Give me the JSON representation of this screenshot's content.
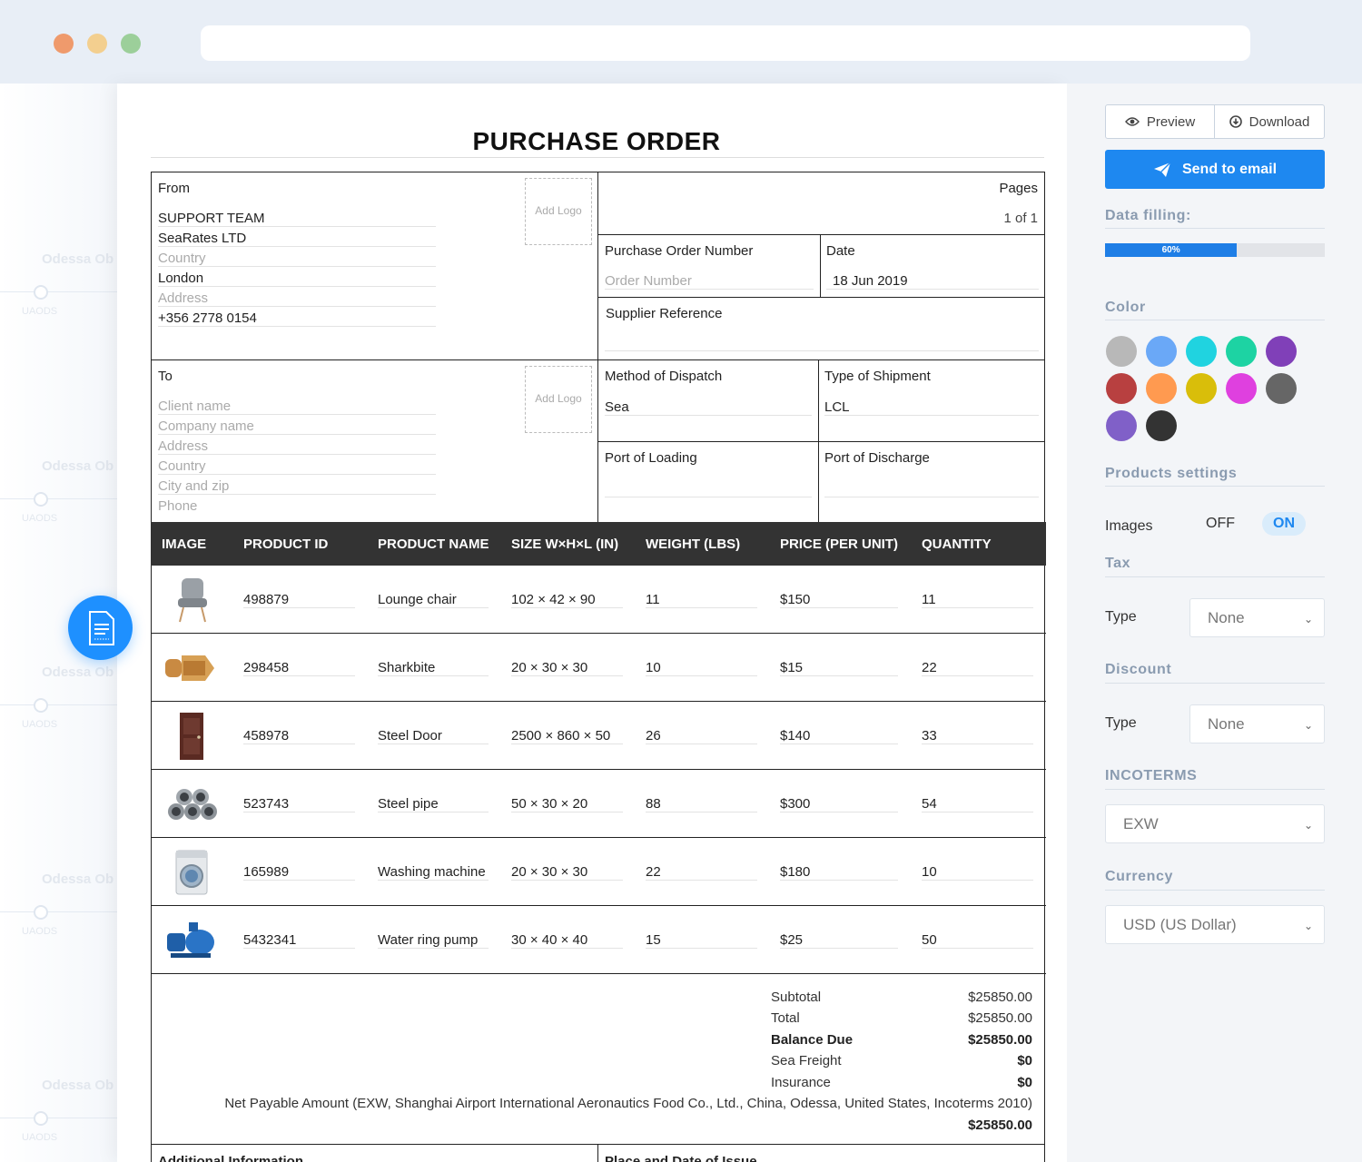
{
  "document": {
    "title": "PURCHASE ORDER",
    "from": {
      "label": "From",
      "name": "SUPPORT TEAM",
      "company": "SeaRates LTD",
      "country_placeholder": "Country",
      "city": "London",
      "address_placeholder": "Address",
      "phone": "+356 2778 0154",
      "logo_label": "Add Logo"
    },
    "pages": {
      "label": "Pages",
      "value": "1 of 1"
    },
    "po_number": {
      "label": "Purchase Order Number",
      "placeholder": "Order Number"
    },
    "date": {
      "label": "Date",
      "value": "18 Jun 2019"
    },
    "supplier_reference": {
      "label": "Supplier Reference"
    },
    "to": {
      "label": "To",
      "client_placeholder": "Client name",
      "company_placeholder": "Company name",
      "address_placeholder": "Address",
      "country_placeholder": "Country",
      "city_placeholder": "City and zip",
      "phone_placeholder": "Phone",
      "logo_label": "Add Logo"
    },
    "method_of_dispatch": {
      "label": "Method of Dispatch",
      "value": "Sea"
    },
    "type_of_shipment": {
      "label": "Type of Shipment",
      "value": "LCL"
    },
    "port_of_loading": {
      "label": "Port of Loading"
    },
    "port_of_discharge": {
      "label": "Port of Discharge"
    },
    "table": {
      "headers": [
        "IMAGE",
        "PRODUCT ID",
        "PRODUCT NAME",
        "SIZE W×H×L (IN)",
        "WEIGHT (LBS)",
        "PRICE (PER UNIT)",
        "QUANTITY"
      ],
      "rows": [
        {
          "image": "lounge-chair",
          "id": "498879",
          "name": "Lounge chair",
          "size": "102 × 42 × 90",
          "weight": "11",
          "price": "$150",
          "quantity": "11"
        },
        {
          "image": "sharkbite-fitting",
          "id": "298458",
          "name": "Sharkbite",
          "size": "20 × 30 × 30",
          "weight": "10",
          "price": "$15",
          "quantity": "22"
        },
        {
          "image": "steel-door",
          "id": "458978",
          "name": "Steel Door",
          "size": "2500 × 860 × 50",
          "weight": "26",
          "price": "$140",
          "quantity": "33"
        },
        {
          "image": "steel-pipes",
          "id": "523743",
          "name": "Steel pipe",
          "size": "50 × 30 × 20",
          "weight": "88",
          "price": "$300",
          "quantity": "54"
        },
        {
          "image": "washing-machine",
          "id": "165989",
          "name": "Washing machine",
          "size": "20 × 30 × 30",
          "weight": "22",
          "price": "$180",
          "quantity": "10"
        },
        {
          "image": "water-ring-pump",
          "id": "5432341",
          "name": "Water ring pump",
          "size": "30 × 40 × 40",
          "weight": "15",
          "price": "$25",
          "quantity": "50"
        }
      ]
    },
    "totals": {
      "subtotal_label": "Subtotal",
      "subtotal": "$25850.00",
      "total_label": "Total",
      "total": "$25850.00",
      "balance_label": "Balance Due",
      "balance": "$25850.00",
      "freight_label": "Sea Freight",
      "freight": "$0",
      "insurance_label": "Insurance",
      "insurance": "$0",
      "net_label": "Net Payable Amount (EXW, Shanghai Airport International Aeronautics Food Co., Ltd., China, Odessa, United States, Incoterms 2010)",
      "net": "$25850.00"
    },
    "footer": {
      "additional_info": "Additional Information",
      "place_date": "Place and Date of Issue"
    }
  },
  "background": {
    "rows": [
      {
        "title": "Odessa Ob",
        "code": "UAODS"
      },
      {
        "title": "Odessa Ob",
        "code": "UAODS"
      },
      {
        "title": "Odessa Ob",
        "code": "UAODS"
      },
      {
        "title": "Odessa Ob",
        "code": "UAODS"
      },
      {
        "title": "Odessa Ob",
        "code": "UAODS"
      }
    ]
  },
  "sidebar": {
    "preview_label": "Preview",
    "download_label": "Download",
    "send_label": "Send to email",
    "data_filling_title": "Data filling:",
    "progress_percent": 60,
    "progress_label": "60%",
    "color_title": "Color",
    "colors": [
      "#b8b8b8",
      "#6aa8f7",
      "#20d3e0",
      "#1dd3a3",
      "#8040b8",
      "#b84040",
      "#ff9a50",
      "#d9be0a",
      "#df40df",
      "#666666",
      "#8060c8",
      "#333333"
    ],
    "products_settings_title": "Products settings",
    "images_label": "Images",
    "images_off": "OFF",
    "images_on": "ON",
    "tax_title": "Tax",
    "tax_type_label": "Type",
    "tax_type_value": "None",
    "discount_title": "Discount",
    "discount_type_label": "Type",
    "discount_type_value": "None",
    "incoterms_title": "INCOTERMS",
    "incoterms_value": "EXW",
    "currency_title": "Currency",
    "currency_value": "USD (US Dollar)"
  }
}
